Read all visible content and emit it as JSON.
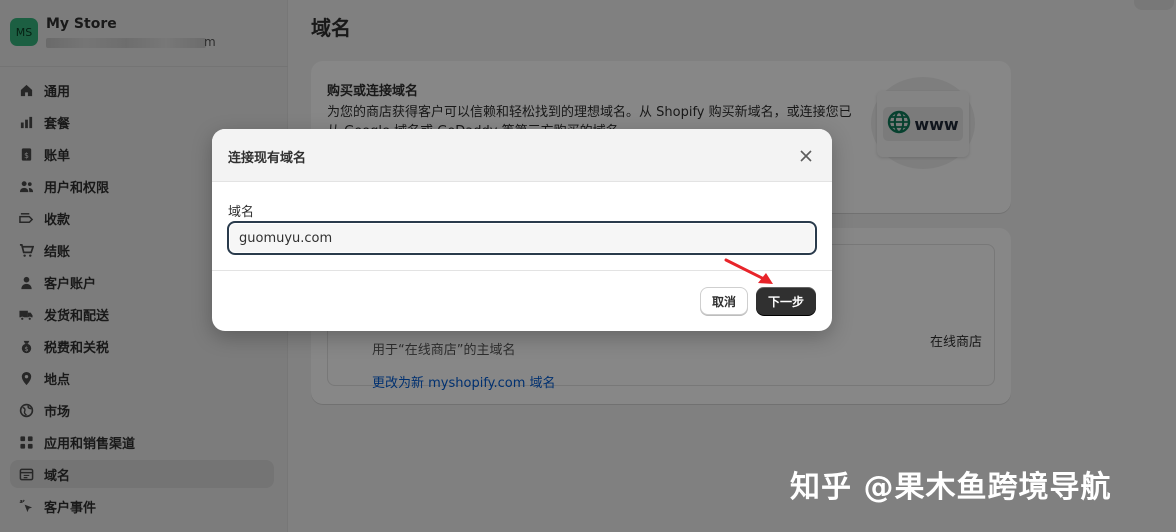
{
  "store": {
    "initials": "MS",
    "name": "My Store",
    "url_tail": "m"
  },
  "nav": [
    {
      "label": "通用",
      "icon": "home-icon"
    },
    {
      "label": "套餐",
      "icon": "chart-bars-icon"
    },
    {
      "label": "账单",
      "icon": "receipt-icon"
    },
    {
      "label": "用户和权限",
      "icon": "users-icon"
    },
    {
      "label": "收款",
      "icon": "payment-icon"
    },
    {
      "label": "结账",
      "icon": "cart-icon"
    },
    {
      "label": "客户账户",
      "icon": "person-icon"
    },
    {
      "label": "发货和配送",
      "icon": "truck-icon"
    },
    {
      "label": "税费和关税",
      "icon": "tax-bag-icon"
    },
    {
      "label": "地点",
      "icon": "location-pin-icon"
    },
    {
      "label": "市场",
      "icon": "globe-icon"
    },
    {
      "label": "应用和销售渠道",
      "icon": "apps-grid-icon"
    },
    {
      "label": "域名",
      "icon": "domain-icon",
      "active": true
    },
    {
      "label": "客户事件",
      "icon": "cursor-click-icon"
    }
  ],
  "page": {
    "title": "域名"
  },
  "buy_card": {
    "title": "购买或连接域名",
    "description": "为您的商店获得客户可以信赖和轻松找到的理想域名。从 Shopify 购买新域名，或连接您已从 Google 域名或 GoDaddy 等第三方购买的域名。",
    "badge_text": "www"
  },
  "domains_card": {
    "subtitle": "用于“在线商店”的主域名",
    "channel": "在线商店",
    "change_link": "更改为新 myshopify.com 域名"
  },
  "modal": {
    "title": "连接现有域名",
    "field_label": "域名",
    "field_value": "guomuyu.com",
    "cancel_label": "取消",
    "next_label": "下一步"
  },
  "watermark": "知乎 @果木鱼跨境导航",
  "colors": {
    "accent_link": "#005bd3",
    "primary_button": "#303030",
    "avatar": "#36b37e",
    "arrow": "#e8242a"
  }
}
